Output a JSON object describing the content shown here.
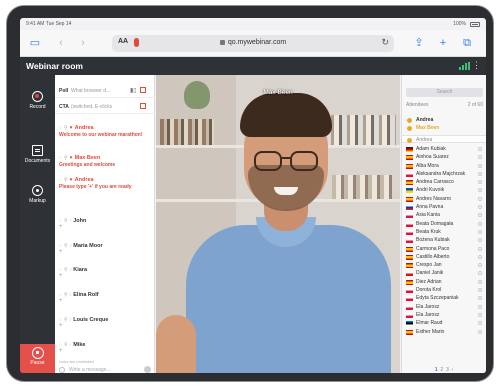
{
  "status": {
    "time": "9:41 AM",
    "date": "Tue Sep 14",
    "battery": "100%"
  },
  "browser": {
    "aa_label": "AA",
    "url": "qo.mywebinar.com"
  },
  "app": {
    "title": "Webinar room"
  },
  "rail": {
    "record": "Record",
    "documents": "Documents",
    "markup": "Markup",
    "pause": "Pause"
  },
  "chat": {
    "poll_label": "Poll",
    "poll_value": "What browser d...",
    "cta_label": "CTA",
    "cta_value": "(switched, E-clicks",
    "messages": [
      {
        "name": "Andrea",
        "text": "Welcome to our webinar marathon!",
        "host": true
      },
      {
        "name": "Max Been",
        "text": "Greetings and welcome",
        "host": true
      },
      {
        "name": "Andrea",
        "text": "Please type '+' if you are ready",
        "host": true
      },
      {
        "name": "John",
        "text": "+",
        "host": false
      },
      {
        "name": "Maria Moor",
        "text": "+",
        "host": false
      },
      {
        "name": "Kiara",
        "text": "+",
        "host": false
      },
      {
        "name": "Elina Rolf",
        "text": "+",
        "host": false
      },
      {
        "name": "Louis Creque",
        "text": "+",
        "host": false
      },
      {
        "name": "Mike",
        "text": "+",
        "host": false
      }
    ],
    "privacy_note": "Links are prohibited",
    "input_placeholder": "Write a message..."
  },
  "video": {
    "presenter_name": "Max Been"
  },
  "attendees": {
    "search_placeholder": "Search",
    "header": "Attendees",
    "count": "2 of 60",
    "hosts": [
      "Andrea",
      "Max Been"
    ],
    "current": "Andrea",
    "list": [
      {
        "name": "Adam Kubiak",
        "flag": "de"
      },
      {
        "name": "Ainhoa Suarez",
        "flag": "es"
      },
      {
        "name": "Alba Mora",
        "flag": "es"
      },
      {
        "name": "Aleksandra Majchrzak",
        "flag": "pl"
      },
      {
        "name": "Andrea Carrasco",
        "flag": "es"
      },
      {
        "name": "Andri Kuvoik",
        "flag": "ua"
      },
      {
        "name": "Andres Navarro",
        "flag": "es"
      },
      {
        "name": "Anna Pavna",
        "flag": "ru"
      },
      {
        "name": "Asia Kania",
        "flag": "pl"
      },
      {
        "name": "Beata Domagała",
        "flag": "pl"
      },
      {
        "name": "Beata Kruk",
        "flag": "pl"
      },
      {
        "name": "Bożena Kubiak",
        "flag": "pl"
      },
      {
        "name": "Carmona Paco",
        "flag": "es"
      },
      {
        "name": "Castillo Alberto",
        "flag": "es"
      },
      {
        "name": "Crespo Jan",
        "flag": "es"
      },
      {
        "name": "Daniel Janik",
        "flag": "cz"
      },
      {
        "name": "Diez Adrian",
        "flag": "es"
      },
      {
        "name": "Dorota Krol",
        "flag": "pl"
      },
      {
        "name": "Edyta Szczepaniak",
        "flag": "pl"
      },
      {
        "name": "Ela Jarosz",
        "flag": "pl"
      },
      {
        "name": "Ela Jarosz",
        "flag": "pl"
      },
      {
        "name": "Elmar Raud",
        "flag": "ee"
      },
      {
        "name": "Esther Marin",
        "flag": "es"
      }
    ],
    "pages": [
      "1",
      "2",
      "3"
    ]
  },
  "colors": {
    "accent": "#e24b3b",
    "dark": "#2e3136",
    "link": "#2f7df6"
  }
}
